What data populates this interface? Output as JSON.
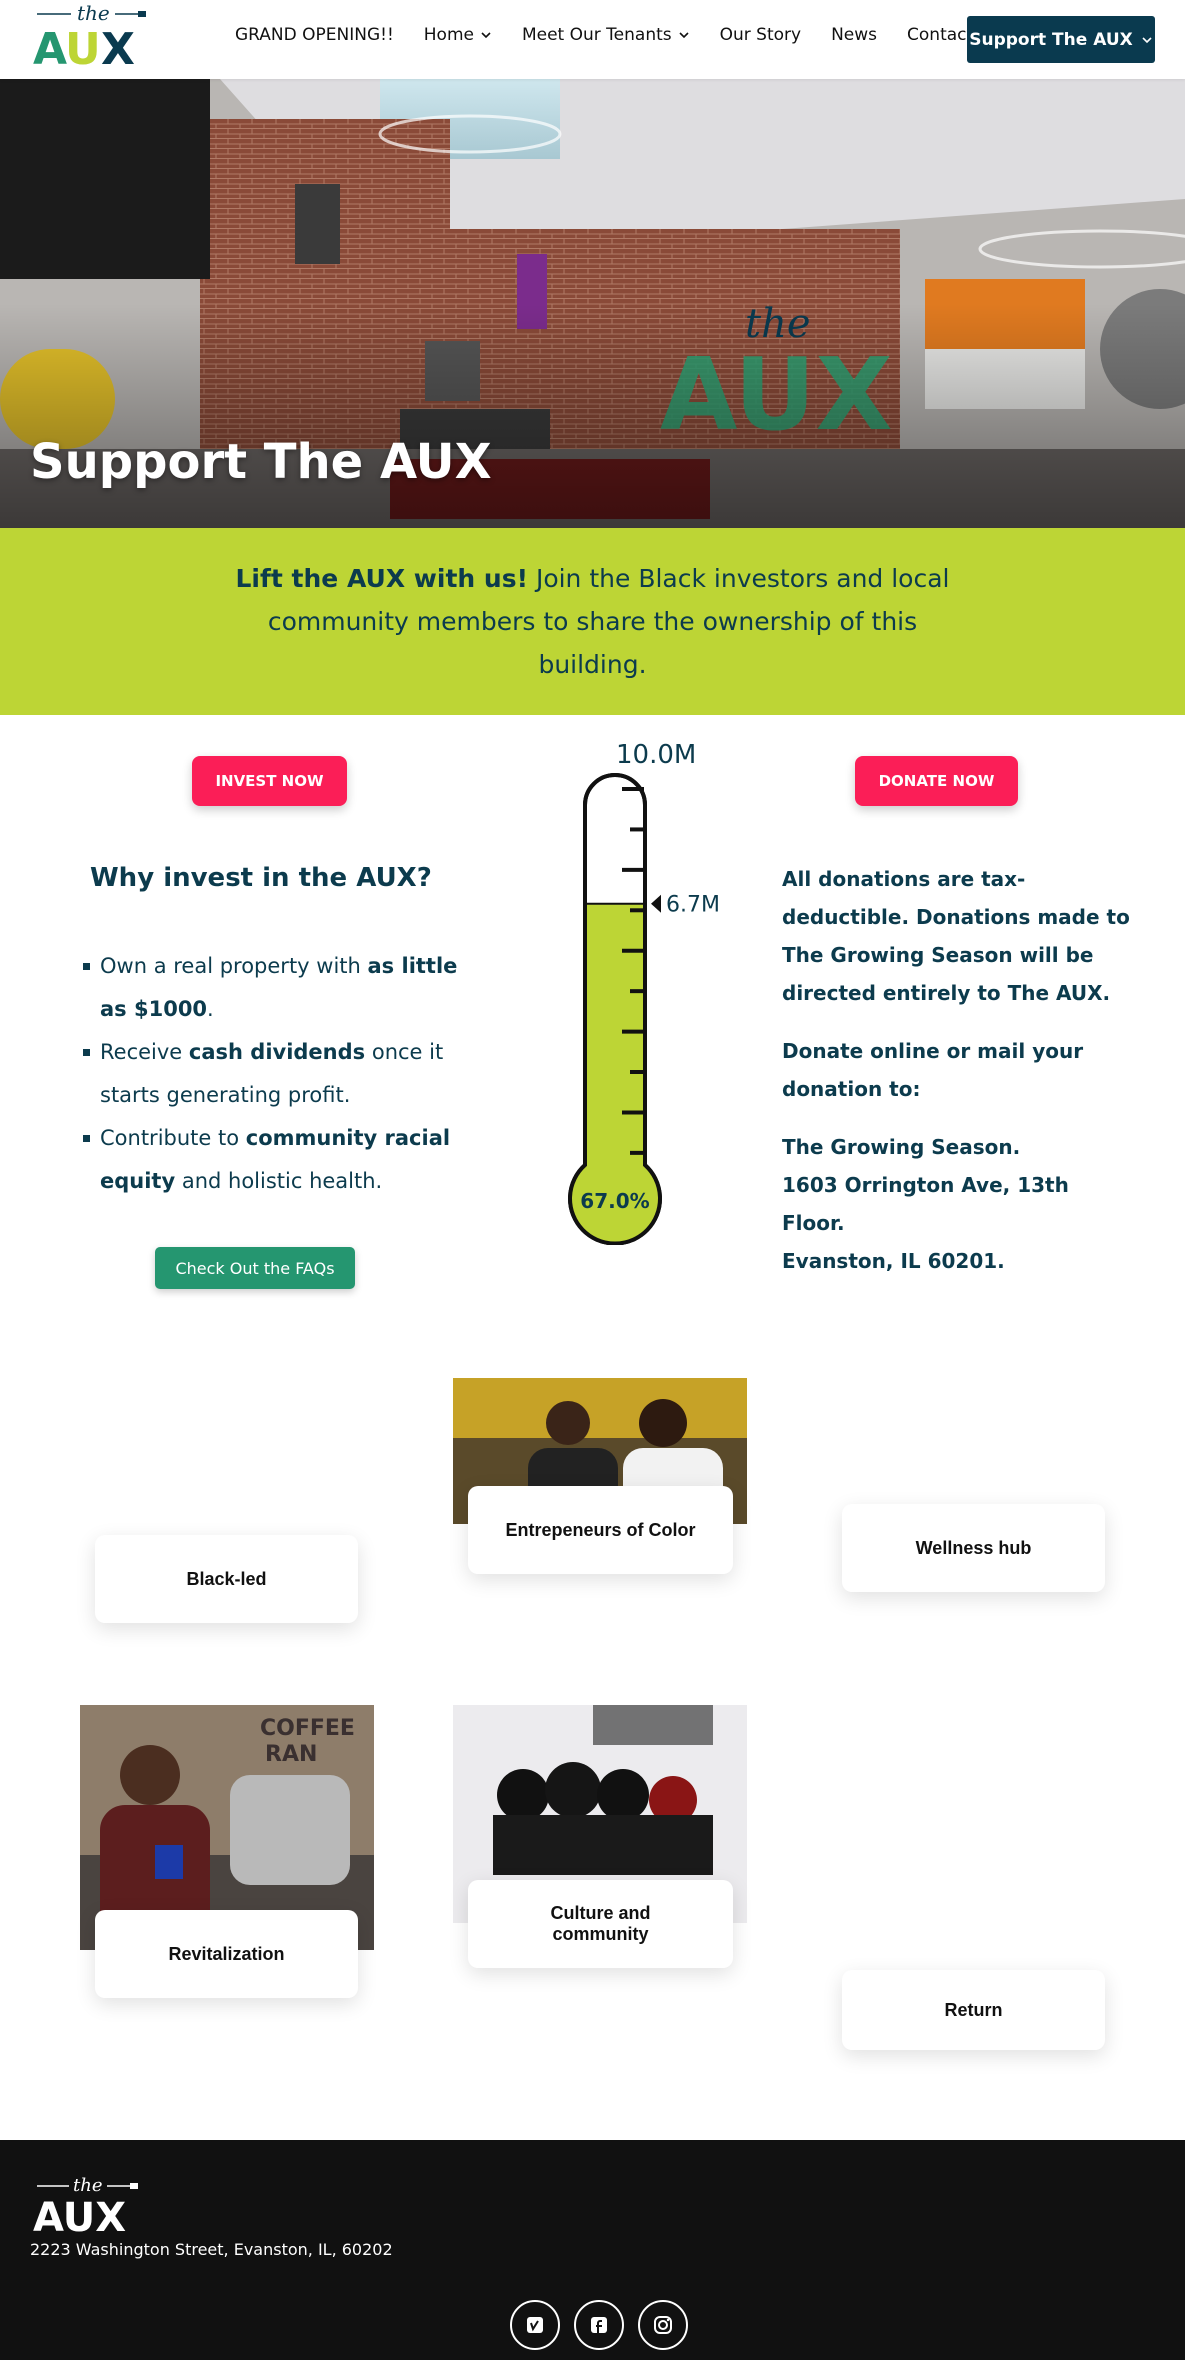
{
  "nav": {
    "items": [
      {
        "label": "GRAND OPENING!!",
        "dropdown": false
      },
      {
        "label": "Home",
        "dropdown": true
      },
      {
        "label": "Meet Our Tenants",
        "dropdown": true
      },
      {
        "label": "Our Story",
        "dropdown": false
      },
      {
        "label": "News",
        "dropdown": false
      },
      {
        "label": "Contact",
        "dropdown": false
      }
    ],
    "support_label": "Support The AUX"
  },
  "hero": {
    "title": "Support The AUX"
  },
  "band": {
    "bold": "Lift the AUX with us!",
    "text": " Join the Black investors and local community members to share the ownership of this building."
  },
  "buttons": {
    "invest": "INVEST NOW",
    "donate": "DONATE NOW",
    "faq": "Check Out the FAQs"
  },
  "why": {
    "title": "Why invest in the AUX?",
    "bullets": [
      {
        "pre": "Own a real property with ",
        "bold": "as little as $1000",
        "post": "."
      },
      {
        "pre": "Receive ",
        "bold": "cash dividends",
        "post": " once it starts generating profit."
      },
      {
        "pre": "Contribute to ",
        "bold": "community racial equity",
        "post": " and holistic health."
      }
    ]
  },
  "thermometer": {
    "goal_label": "10.0M",
    "current_label": "6.7M",
    "percent_label": "67.0%",
    "fraction": 0.67
  },
  "donate": {
    "p1": "All donations are tax-deductible. Donations made to The Growing Season will be directed entirely to The AUX.",
    "p2": "Donate online or mail your donation to:",
    "addr1": "The Growing Season.",
    "addr2": "1603 Orrington Ave, 13th Floor.",
    "addr3": "Evanston, IL 60201."
  },
  "cards": {
    "black_led": "Black-led",
    "entrepreneurs": "Entrepeneurs of Color",
    "wellness": "Wellness hub",
    "revitalization": "Revitalization",
    "culture": "Culture and community",
    "return": "Return"
  },
  "footer": {
    "address": "2223 Washington Street, Evanston, IL, 60202",
    "social": [
      "vimeo-icon",
      "facebook-icon",
      "instagram-icon"
    ]
  },
  "colors": {
    "navy": "#0a3a4f",
    "lime": "#bdd535",
    "pink": "#fb1e57",
    "green": "#259670"
  }
}
